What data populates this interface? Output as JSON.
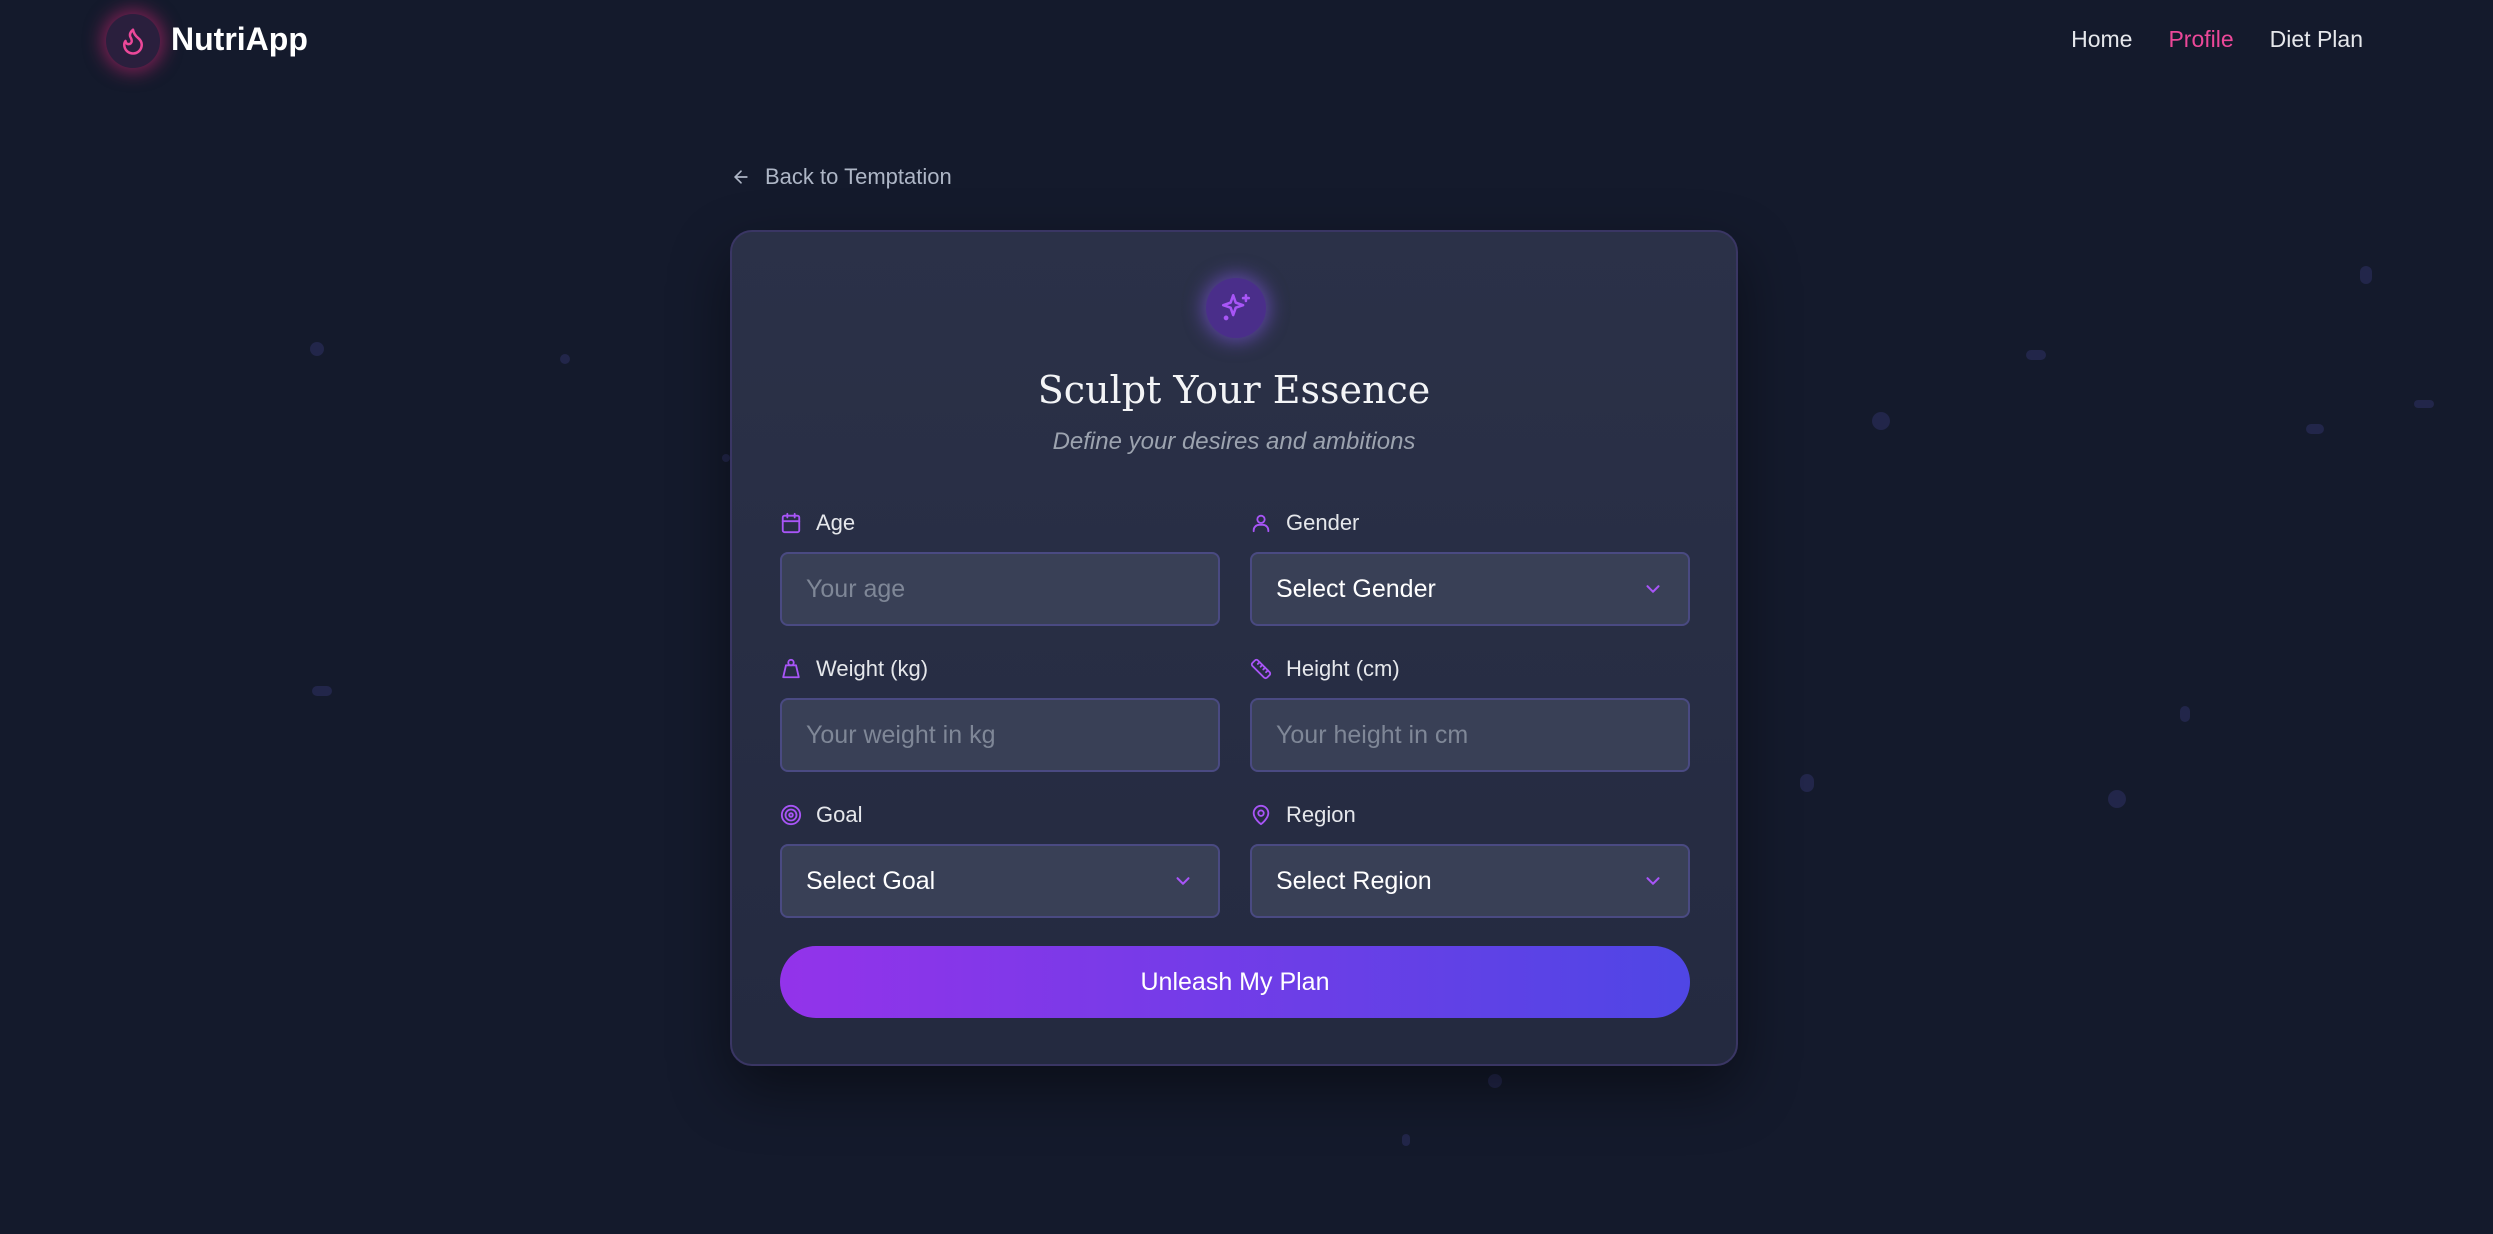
{
  "app": {
    "name": "NutriApp",
    "logo_icon": "flame-icon",
    "accent_color": "#ec4899"
  },
  "nav": {
    "items": [
      {
        "label": "Home",
        "active": false
      },
      {
        "label": "Profile",
        "active": true
      },
      {
        "label": "Diet Plan",
        "active": false
      }
    ]
  },
  "back_link": {
    "label": "Back to Temptation",
    "icon": "arrow-left-icon"
  },
  "card": {
    "icon": "sparkles-icon",
    "title": "Sculpt Your Essence",
    "subtitle": "Define your desires and ambitions"
  },
  "form": {
    "age": {
      "label": "Age",
      "icon": "calendar-icon",
      "placeholder": "Your age",
      "value": ""
    },
    "gender": {
      "label": "Gender",
      "icon": "user-icon",
      "selected": "Select Gender"
    },
    "weight": {
      "label": "Weight (kg)",
      "icon": "weight-icon",
      "placeholder": "Your weight in kg",
      "value": ""
    },
    "height": {
      "label": "Height (cm)",
      "icon": "ruler-icon",
      "placeholder": "Your height in cm",
      "value": ""
    },
    "goal": {
      "label": "Goal",
      "icon": "target-icon",
      "selected": "Select Goal"
    },
    "region": {
      "label": "Region",
      "icon": "map-pin-icon",
      "selected": "Select Region"
    },
    "submit_label": "Unleash My Plan"
  },
  "colors": {
    "background": "#141a2c",
    "card": "#2b3148",
    "icon_purple": "#a855f7",
    "button_gradient_start": "#9333ea",
    "button_gradient_end": "#4f46e5"
  }
}
